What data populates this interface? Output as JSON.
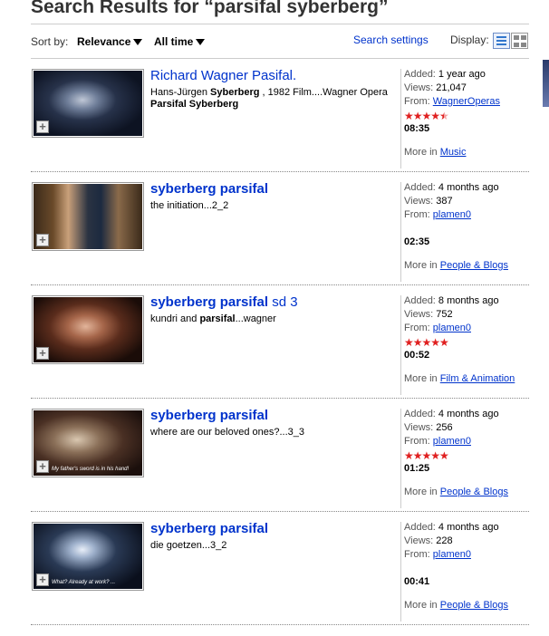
{
  "page": {
    "title": "Search Results for “parsifal syberberg”"
  },
  "toolbar": {
    "sort_label": "Sort by:",
    "sort_value": "Relevance",
    "time_value": "All time",
    "search_settings": "Search settings",
    "display_label": "Display:"
  },
  "results": [
    {
      "title_parts": [
        "Richard Wagner Pasifal.",
        "",
        ""
      ],
      "desc_parts": [
        "Hans-Jürgen ",
        "Syberberg",
        " , 1982 Film....Wagner Opera ",
        "Parsifal Syberberg",
        ""
      ],
      "added": "1 year ago",
      "views": "21,047",
      "from": "WagnerOperas",
      "rating": 4.5,
      "stars": "★★★★★",
      "duration": "08:35",
      "category": "Music",
      "thumb_caption": ""
    },
    {
      "title_parts": [
        "",
        "syberberg parsifal",
        ""
      ],
      "desc_parts": [
        "the initiation...2_2",
        "",
        "",
        "",
        ""
      ],
      "added": "4 months ago",
      "views": "387",
      "from": "plamen0",
      "rating": 0,
      "stars": "",
      "duration": "02:35",
      "category": "People & Blogs",
      "thumb_caption": ""
    },
    {
      "title_parts": [
        "",
        "syberberg parsifal",
        " sd 3"
      ],
      "desc_parts": [
        "kundri and ",
        "parsifal",
        "...wagner",
        "",
        ""
      ],
      "added": "8 months ago",
      "views": "752",
      "from": "plamen0",
      "rating": 5,
      "stars": "★★★★★",
      "duration": "00:52",
      "category": "Film & Animation",
      "thumb_caption": ""
    },
    {
      "title_parts": [
        "",
        "syberberg parsifal",
        ""
      ],
      "desc_parts": [
        "where are our beloved ones?...3_3",
        "",
        "",
        "",
        ""
      ],
      "added": "4 months ago",
      "views": "256",
      "from": "plamen0",
      "rating": 5,
      "stars": "★★★★★",
      "duration": "01:25",
      "category": "People & Blogs",
      "thumb_caption": "My father's sword is in his hand!"
    },
    {
      "title_parts": [
        "",
        "syberberg parsifal",
        ""
      ],
      "desc_parts": [
        "die goetzen...3_2",
        "",
        "",
        "",
        ""
      ],
      "added": "4 months ago",
      "views": "228",
      "from": "plamen0",
      "rating": 0,
      "stars": "",
      "duration": "00:41",
      "category": "People & Blogs",
      "thumb_caption": "What? Already at work? ..."
    }
  ],
  "meta_labels": {
    "added": "Added: ",
    "views": "Views: ",
    "from": "From: ",
    "more_in": "More in "
  },
  "thumb_plus": "+",
  "colors": {
    "link": "#0033cc",
    "stars": "#e02020",
    "title": "#333333"
  }
}
